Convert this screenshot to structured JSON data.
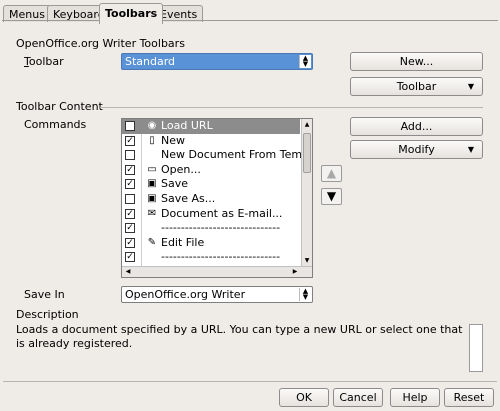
{
  "tabs": [
    {
      "label": "Menus",
      "active": false
    },
    {
      "label": "Keyboard",
      "active": false
    },
    {
      "label": "Toolbars",
      "active": true
    },
    {
      "label": "Events",
      "active": false
    }
  ],
  "toolbars_section": {
    "title": "OpenOffice.org Writer Toolbars",
    "toolbar_label": "Toolbar",
    "toolbar_value": "Standard",
    "new_button": "New...",
    "toolbar_button": "Toolbar"
  },
  "content_section": {
    "title": "Toolbar Content",
    "commands_label": "Commands",
    "add_button": "Add...",
    "modify_button": "Modify",
    "commands": [
      {
        "label": "Load URL",
        "checked": false,
        "icon": "globe-icon",
        "glyph": "◉",
        "selected": true
      },
      {
        "label": "New",
        "checked": true,
        "icon": "document-icon",
        "glyph": "▯",
        "selected": false
      },
      {
        "label": "New Document From Template",
        "checked": false,
        "icon": "",
        "glyph": "",
        "selected": false
      },
      {
        "label": "Open...",
        "checked": true,
        "icon": "folder-icon",
        "glyph": "▭",
        "selected": false
      },
      {
        "label": "Save",
        "checked": true,
        "icon": "floppy-icon",
        "glyph": "▣",
        "selected": false
      },
      {
        "label": "Save As...",
        "checked": false,
        "icon": "save-as-icon",
        "glyph": "▣",
        "selected": false
      },
      {
        "label": "Document as E-mail...",
        "checked": true,
        "icon": "envelope-icon",
        "glyph": "✉",
        "selected": false
      },
      {
        "label": "------------------------------",
        "checked": true,
        "icon": "",
        "glyph": "",
        "selected": false
      },
      {
        "label": "Edit File",
        "checked": true,
        "icon": "edit-file-icon",
        "glyph": "✎",
        "selected": false
      },
      {
        "label": "------------------------------",
        "checked": true,
        "icon": "",
        "glyph": "",
        "selected": false
      }
    ]
  },
  "save_in": {
    "label": "Save In",
    "value": "OpenOffice.org Writer"
  },
  "description": {
    "label": "Description",
    "text": "Loads a document specified by a URL. You can type a new URL or select one that is already registered."
  },
  "footer": {
    "ok": "OK",
    "cancel": "Cancel",
    "help": "Help",
    "reset": "Reset"
  }
}
